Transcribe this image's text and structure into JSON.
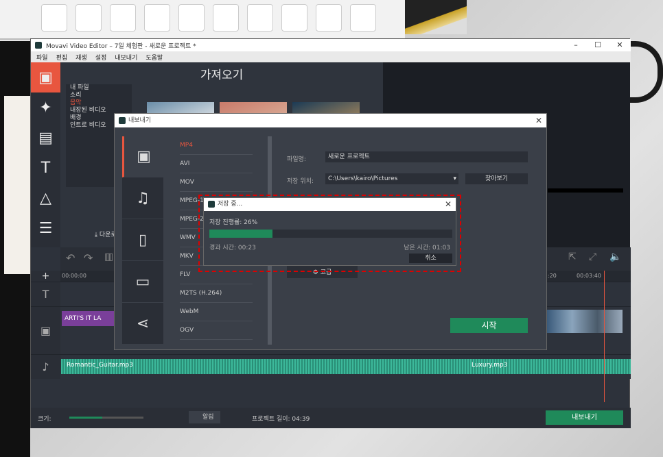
{
  "window": {
    "title": "Movavi Video Editor – 7일 체험판 - 새로운 프로젝트 *"
  },
  "menu": [
    "파일",
    "편집",
    "재생",
    "설정",
    "내보내기",
    "도움말"
  ],
  "import": {
    "title": "가져오기",
    "categories": [
      "내 파일",
      "소리",
      "음악",
      "내장된 비디오",
      "배경",
      "인트로 비디오"
    ],
    "selected_category": "음악",
    "download_label": "다운로드"
  },
  "timeline": {
    "start_time": "00:00:00",
    "ruler_20": ":20",
    "ruler_end": "00:03:40",
    "text_clip": "ARTI'S IT LA",
    "audio_clip_1": "Romantic_Guitar.mp3",
    "audio_clip_2": "Luxury.mp3"
  },
  "status": {
    "size_label": "크기:",
    "alarm_label": "알림",
    "project_length": "프로젝트 길이: 04:39",
    "export_label": "내보내기"
  },
  "export_dialog": {
    "title": "내보내기",
    "formats": [
      "MP4",
      "AVI",
      "MOV",
      "MPEG-1",
      "MPEG-2",
      "WMV",
      "MKV",
      "FLV",
      "M2TS (H.264)",
      "WebM",
      "OGV"
    ],
    "selected_format": "MP4",
    "filename_label": "파일명:",
    "filename_value": "새로운 프로젝트",
    "save_location_label": "저장 위치:",
    "save_location_value": "C:\\Users\\kairo\\Pictures",
    "browse_label": "찾아보기",
    "advanced_label": "고급",
    "start_label": "시작"
  },
  "progress_dialog": {
    "title": "저장 중...",
    "progress_text": "저장 진행률: 26%",
    "progress_value": 26,
    "elapsed": "경과 시간: 00:23",
    "remaining": "남은 시간: 01:03",
    "cancel_label": "취소"
  },
  "colors": {
    "accent": "#e8563f",
    "green": "#1f8a5a",
    "highlight": "#dd0000"
  }
}
